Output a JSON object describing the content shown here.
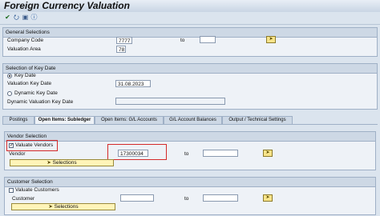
{
  "window": {
    "title": "Foreign Currency Valuation"
  },
  "toolbar": {
    "icons": [
      "execute-icon",
      "variant-icon",
      "save-icon",
      "info-icon"
    ]
  },
  "general": {
    "title": "General Selections",
    "company_code_label": "Company Code",
    "company_code_value": "7777",
    "to_label": "to",
    "company_code_to": "",
    "valuation_area_label": "Valuation Area",
    "valuation_area_value": "78"
  },
  "keydate": {
    "title": "Selection of Key Date",
    "key_date_option": "Key Date",
    "valuation_key_date_label": "Valuation Key Date",
    "valuation_key_date_value": "31.08.2023",
    "dynamic_option": "Dynamic Key Date",
    "dynamic_key_date_label": "Dynamic Valuation Key Date",
    "dynamic_key_date_value": ""
  },
  "tabs": [
    {
      "label": "Postings"
    },
    {
      "label": "Open Items: Subledger"
    },
    {
      "label": "Open Items: G/L Accounts"
    },
    {
      "label": "G/L Account Balances"
    },
    {
      "label": "Output / Technical Settings"
    }
  ],
  "vendor": {
    "title": "Vendor Selection",
    "checkbox_label": "Valuate Vendors",
    "checked": true,
    "vendor_label": "Vendor",
    "vendor_value": "17300034",
    "to_label": "to",
    "vendor_to": "",
    "selections_label": "Selections"
  },
  "customer": {
    "title": "Customer Selection",
    "checkbox_label": "Valuate Customers",
    "checked": false,
    "customer_label": "Customer",
    "customer_value": "",
    "to_label": "to",
    "customer_to": "",
    "selections_label": "Selections"
  },
  "colors": {
    "highlight": "#d42a2a",
    "accent": "#f8e48a"
  }
}
